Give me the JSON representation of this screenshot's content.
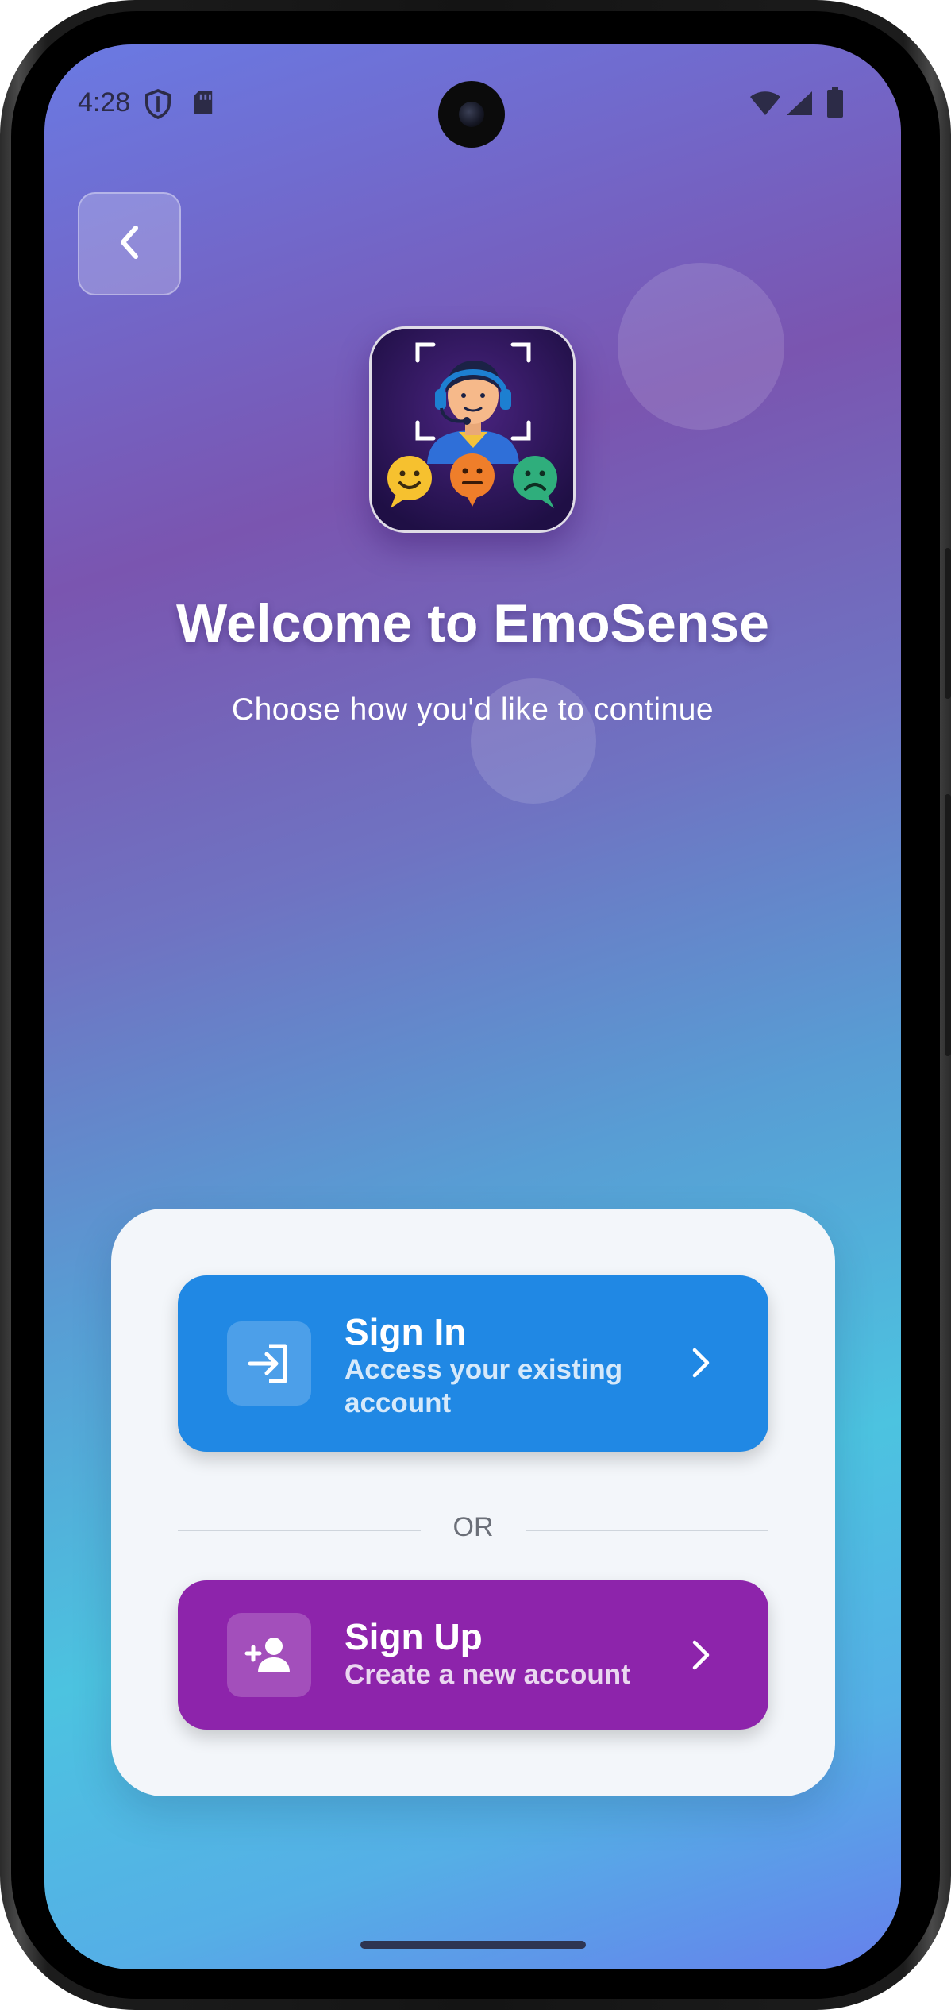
{
  "status_bar": {
    "time": "4:28",
    "icons": [
      "shield-icon",
      "sd-card-icon",
      "wifi-icon",
      "signal-icon",
      "battery-icon"
    ]
  },
  "back_button": {
    "icon": "chevron-left-icon"
  },
  "header": {
    "title": "Welcome to EmoSense",
    "subtitle": "Choose how you'd like to continue"
  },
  "sign_in": {
    "title": "Sign In",
    "subtitle": "Access your existing account",
    "icon": "login-icon",
    "color": "#2088e4"
  },
  "divider": {
    "label": "OR"
  },
  "sign_up": {
    "title": "Sign Up",
    "subtitle": "Create a new account",
    "icon": "add-person-icon",
    "color": "#8d24ab"
  },
  "colors": {
    "card_bg": "#f3f6fa",
    "gradient_top": "#6a7ae3",
    "gradient_mid": "#7a55b0",
    "gradient_bottom": "#4cc3e0"
  }
}
